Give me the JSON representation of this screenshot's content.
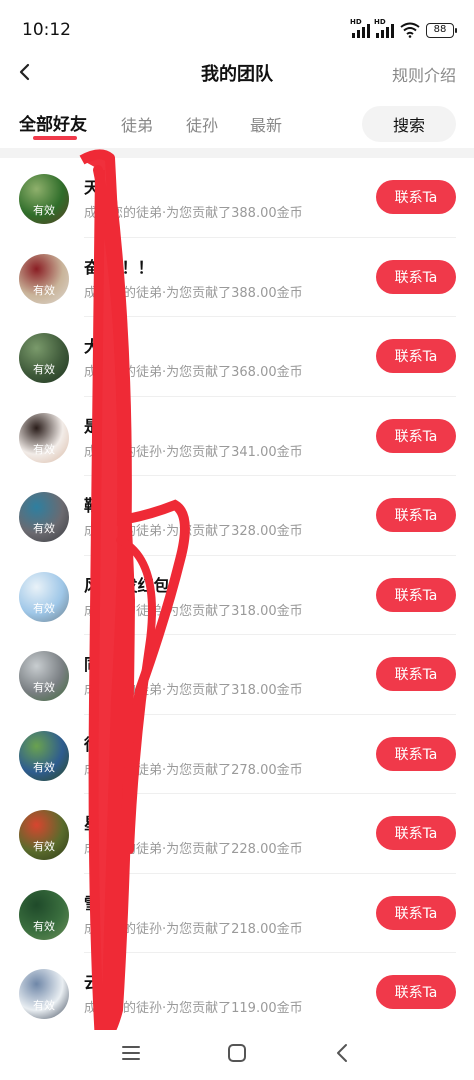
{
  "status": {
    "time": "10:12",
    "battery": "88",
    "signal_label": "HD"
  },
  "nav": {
    "title": "我的团队",
    "rules_label": "规则介绍"
  },
  "tabs": [
    {
      "label": "全部好友",
      "active": true
    },
    {
      "label": "徒弟",
      "active": false
    },
    {
      "label": "徒孙",
      "active": false
    },
    {
      "label": "最新",
      "active": false
    }
  ],
  "search_label": "搜索",
  "contact_label": "联系Ta",
  "badge_label": "有效",
  "rows": [
    {
      "name": "天",
      "desc": "成为您的徒弟·为您贡献了388.00金币",
      "avatar": [
        "#2f6d2a",
        "#8fb06c",
        "#5a3f24"
      ]
    },
    {
      "name": "奋  ！！！",
      "desc": "成为您的徒弟·为您贡献了388.00金币",
      "avatar": [
        "#c9b49a",
        "#8a1e24",
        "#ded7cf"
      ]
    },
    {
      "name": "大  号",
      "desc": "成为您的徒弟·为您贡献了368.00金币",
      "avatar": [
        "#3f5a3a",
        "#7a9a6b",
        "#1f3420"
      ]
    },
    {
      "name": "是",
      "desc": "成为您的徒孙·为您贡献了341.00金币",
      "avatar": [
        "#f2ece8",
        "#2a1d1a",
        "#d9b9a5"
      ]
    },
    {
      "name": "鞋  软",
      "desc": "成为您的徒弟·为您贡献了328.00金币",
      "avatar": [
        "#6b6a70",
        "#2e7fa0",
        "#3a3c40"
      ]
    },
    {
      "name": "风  你发红包",
      "desc": "成为您的徒弟·为您贡献了318.00金币",
      "avatar": [
        "#9fc7e8",
        "#e9f2f8",
        "#6a7f8c"
      ]
    },
    {
      "name": "同",
      "desc": "成为您的徒弟·为您贡献了318.00金币",
      "avatar": [
        "#7a7f83",
        "#c8cdd0",
        "#3f6a39"
      ]
    },
    {
      "name": "徐",
      "desc": "成为您的徒弟·为您贡献了278.00金币",
      "avatar": [
        "#2e5c8f",
        "#6aa24f",
        "#2c4a22"
      ]
    },
    {
      "name": "星  海",
      "desc": "成为您的徒弟·为您贡献了228.00金币",
      "avatar": [
        "#5a6b2c",
        "#d8452f",
        "#2f3a18"
      ]
    },
    {
      "name": "雪",
      "desc": "成为您的徒孙·为您贡献了218.00金币",
      "avatar": [
        "#3a6e3e",
        "#1f4a2a",
        "#6c8f5a"
      ]
    },
    {
      "name": "云",
      "desc": "成为您的徒孙·为您贡献了119.00金币",
      "avatar": [
        "#e9eef2",
        "#6f87a8",
        "#3a4556"
      ]
    }
  ]
}
